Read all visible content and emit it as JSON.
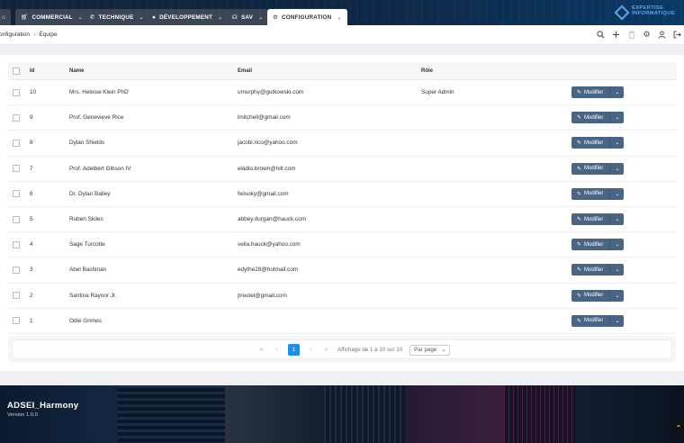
{
  "nav": {
    "home_icon": "home-icon",
    "tabs": [
      {
        "label": "COMMERCIAL",
        "icon": "cart-icon"
      },
      {
        "label": "TECHNIQUE",
        "icon": "phone-icon"
      },
      {
        "label": "DÉVELOPPEMENT",
        "icon": "apple-icon"
      },
      {
        "label": "SAV",
        "icon": "headset-icon"
      },
      {
        "label": "CONFIGURATION",
        "icon": "gear-icon"
      }
    ],
    "active_tab": "CONFIGURATION",
    "logo_line1": "EXPERTISE",
    "logo_line2": "INFORMATIQUE"
  },
  "breadcrumb": {
    "parent": "onfiguration",
    "current": "Équipe"
  },
  "toolbar": {
    "icons": [
      "search-icon",
      "plus-icon",
      "trash-icon",
      "gear-icon",
      "user-icon",
      "logout-icon"
    ]
  },
  "table": {
    "headers": {
      "id": "Id",
      "name": "Name",
      "email": "Email",
      "role": "Rôle"
    },
    "rows": [
      {
        "id": "10",
        "name": "Mrs. Heloise Klein PhD",
        "email": "umurphy@gutkowski.com",
        "role": "Super Admin"
      },
      {
        "id": "9",
        "name": "Prof. Genevieve Rice",
        "email": "lmitchell@gmail.com",
        "role": ""
      },
      {
        "id": "8",
        "name": "Dylan Shields",
        "email": "jacobi.rico@yahoo.com",
        "role": ""
      },
      {
        "id": "7",
        "name": "Prof. Adelbert Gibson IV",
        "email": "eladio.brown@hill.com",
        "role": ""
      },
      {
        "id": "6",
        "name": "Dr. Dylan Bailey",
        "email": "fwisoky@gmail.com",
        "role": ""
      },
      {
        "id": "5",
        "name": "Ruben Skiles",
        "email": "abbey.durgan@hauck.com",
        "role": ""
      },
      {
        "id": "4",
        "name": "Sage Turcotte",
        "email": "vella.hauck@yahoo.com",
        "role": ""
      },
      {
        "id": "3",
        "name": "Abel Bashirian",
        "email": "edythe28@hotmail.com",
        "role": ""
      },
      {
        "id": "2",
        "name": "Santina Raynor Jr.",
        "email": "jtreutel@gmail.com",
        "role": ""
      },
      {
        "id": "1",
        "name": "Odie Grimes",
        "email": "",
        "role": ""
      }
    ],
    "edit_label": "Modifier"
  },
  "pagination": {
    "current_page": "1",
    "summary": "Affichage de 1 à 10 sur 10",
    "per_page_label": "Par page"
  },
  "footer": {
    "brand": "ADSEI_Harmony",
    "version": "Version 1.0.0"
  },
  "colors": {
    "nav_bg": "#0e2746",
    "tab_bg": "#3b4553",
    "button": "#4a6583",
    "page_active": "#1c8fe3"
  }
}
